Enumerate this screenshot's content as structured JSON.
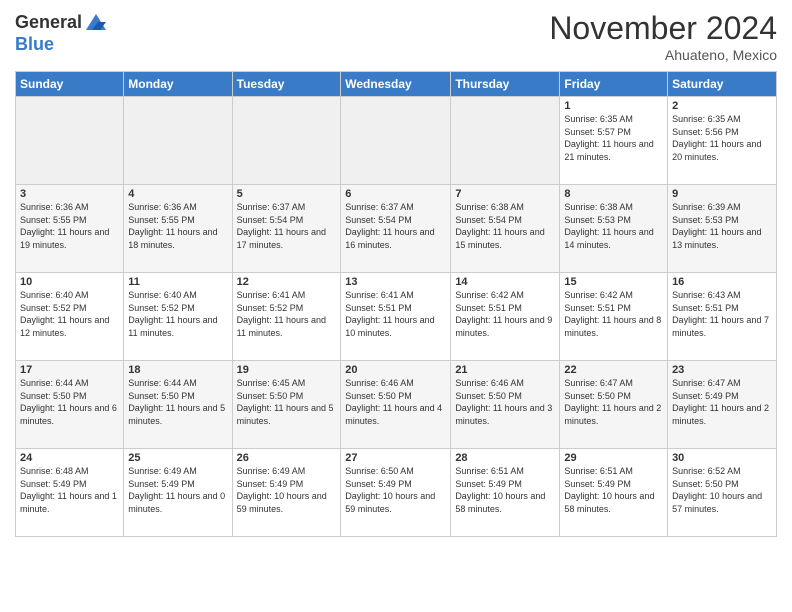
{
  "header": {
    "logo_general": "General",
    "logo_blue": "Blue",
    "month": "November 2024",
    "location": "Ahuateno, Mexico"
  },
  "weekdays": [
    "Sunday",
    "Monday",
    "Tuesday",
    "Wednesday",
    "Thursday",
    "Friday",
    "Saturday"
  ],
  "rows": [
    [
      {
        "day": "",
        "info": ""
      },
      {
        "day": "",
        "info": ""
      },
      {
        "day": "",
        "info": ""
      },
      {
        "day": "",
        "info": ""
      },
      {
        "day": "",
        "info": ""
      },
      {
        "day": "1",
        "info": "Sunrise: 6:35 AM\nSunset: 5:57 PM\nDaylight: 11 hours and 21 minutes."
      },
      {
        "day": "2",
        "info": "Sunrise: 6:35 AM\nSunset: 5:56 PM\nDaylight: 11 hours and 20 minutes."
      }
    ],
    [
      {
        "day": "3",
        "info": "Sunrise: 6:36 AM\nSunset: 5:55 PM\nDaylight: 11 hours and 19 minutes."
      },
      {
        "day": "4",
        "info": "Sunrise: 6:36 AM\nSunset: 5:55 PM\nDaylight: 11 hours and 18 minutes."
      },
      {
        "day": "5",
        "info": "Sunrise: 6:37 AM\nSunset: 5:54 PM\nDaylight: 11 hours and 17 minutes."
      },
      {
        "day": "6",
        "info": "Sunrise: 6:37 AM\nSunset: 5:54 PM\nDaylight: 11 hours and 16 minutes."
      },
      {
        "day": "7",
        "info": "Sunrise: 6:38 AM\nSunset: 5:54 PM\nDaylight: 11 hours and 15 minutes."
      },
      {
        "day": "8",
        "info": "Sunrise: 6:38 AM\nSunset: 5:53 PM\nDaylight: 11 hours and 14 minutes."
      },
      {
        "day": "9",
        "info": "Sunrise: 6:39 AM\nSunset: 5:53 PM\nDaylight: 11 hours and 13 minutes."
      }
    ],
    [
      {
        "day": "10",
        "info": "Sunrise: 6:40 AM\nSunset: 5:52 PM\nDaylight: 11 hours and 12 minutes."
      },
      {
        "day": "11",
        "info": "Sunrise: 6:40 AM\nSunset: 5:52 PM\nDaylight: 11 hours and 11 minutes."
      },
      {
        "day": "12",
        "info": "Sunrise: 6:41 AM\nSunset: 5:52 PM\nDaylight: 11 hours and 11 minutes."
      },
      {
        "day": "13",
        "info": "Sunrise: 6:41 AM\nSunset: 5:51 PM\nDaylight: 11 hours and 10 minutes."
      },
      {
        "day": "14",
        "info": "Sunrise: 6:42 AM\nSunset: 5:51 PM\nDaylight: 11 hours and 9 minutes."
      },
      {
        "day": "15",
        "info": "Sunrise: 6:42 AM\nSunset: 5:51 PM\nDaylight: 11 hours and 8 minutes."
      },
      {
        "day": "16",
        "info": "Sunrise: 6:43 AM\nSunset: 5:51 PM\nDaylight: 11 hours and 7 minutes."
      }
    ],
    [
      {
        "day": "17",
        "info": "Sunrise: 6:44 AM\nSunset: 5:50 PM\nDaylight: 11 hours and 6 minutes."
      },
      {
        "day": "18",
        "info": "Sunrise: 6:44 AM\nSunset: 5:50 PM\nDaylight: 11 hours and 5 minutes."
      },
      {
        "day": "19",
        "info": "Sunrise: 6:45 AM\nSunset: 5:50 PM\nDaylight: 11 hours and 5 minutes."
      },
      {
        "day": "20",
        "info": "Sunrise: 6:46 AM\nSunset: 5:50 PM\nDaylight: 11 hours and 4 minutes."
      },
      {
        "day": "21",
        "info": "Sunrise: 6:46 AM\nSunset: 5:50 PM\nDaylight: 11 hours and 3 minutes."
      },
      {
        "day": "22",
        "info": "Sunrise: 6:47 AM\nSunset: 5:50 PM\nDaylight: 11 hours and 2 minutes."
      },
      {
        "day": "23",
        "info": "Sunrise: 6:47 AM\nSunset: 5:49 PM\nDaylight: 11 hours and 2 minutes."
      }
    ],
    [
      {
        "day": "24",
        "info": "Sunrise: 6:48 AM\nSunset: 5:49 PM\nDaylight: 11 hours and 1 minute."
      },
      {
        "day": "25",
        "info": "Sunrise: 6:49 AM\nSunset: 5:49 PM\nDaylight: 11 hours and 0 minutes."
      },
      {
        "day": "26",
        "info": "Sunrise: 6:49 AM\nSunset: 5:49 PM\nDaylight: 10 hours and 59 minutes."
      },
      {
        "day": "27",
        "info": "Sunrise: 6:50 AM\nSunset: 5:49 PM\nDaylight: 10 hours and 59 minutes."
      },
      {
        "day": "28",
        "info": "Sunrise: 6:51 AM\nSunset: 5:49 PM\nDaylight: 10 hours and 58 minutes."
      },
      {
        "day": "29",
        "info": "Sunrise: 6:51 AM\nSunset: 5:49 PM\nDaylight: 10 hours and 58 minutes."
      },
      {
        "day": "30",
        "info": "Sunrise: 6:52 AM\nSunset: 5:50 PM\nDaylight: 10 hours and 57 minutes."
      }
    ]
  ]
}
